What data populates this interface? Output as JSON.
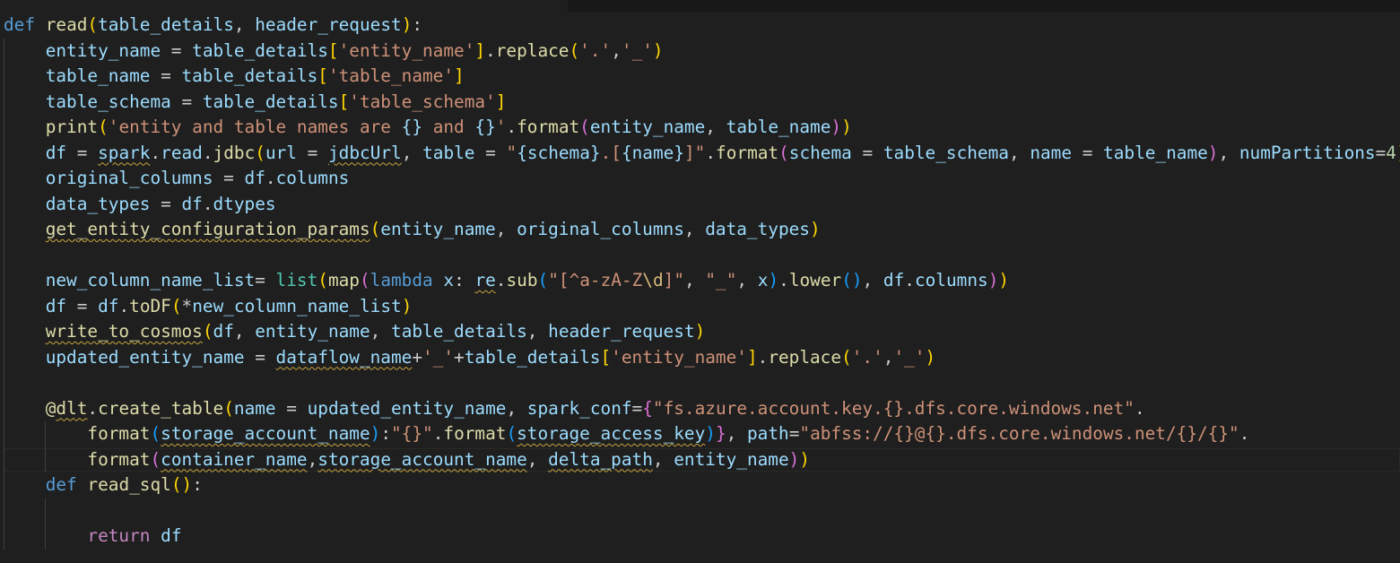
{
  "editor": {
    "language": "python",
    "current_line_index": 17,
    "colors": {
      "background": "#1f1f1f",
      "keyword": "#569cd6",
      "function": "#dcdcaa",
      "variable": "#9cdcfe",
      "string": "#ce9178",
      "number": "#b5cea8",
      "control": "#c586c0",
      "builtin": "#4ec9b0",
      "bracket_1": "#ffd700",
      "bracket_2": "#da70d6",
      "bracket_3": "#179fff",
      "squiggle": "#c8a43c"
    },
    "lines": [
      {
        "indent": 0,
        "tokens": [
          [
            "kw",
            "def"
          ],
          [
            "pun",
            " "
          ],
          [
            "fn",
            "read"
          ],
          [
            "b1",
            "("
          ],
          [
            "var",
            "table_details"
          ],
          [
            "pun",
            ", "
          ],
          [
            "var",
            "header_request"
          ],
          [
            "b1",
            ")"
          ],
          [
            "pun",
            ":"
          ]
        ]
      },
      {
        "indent": 1,
        "tokens": [
          [
            "var",
            "entity_name"
          ],
          [
            "pun",
            " = "
          ],
          [
            "var",
            "table_details"
          ],
          [
            "b1",
            "["
          ],
          [
            "str",
            "'entity_name'"
          ],
          [
            "b1",
            "]"
          ],
          [
            "pun",
            "."
          ],
          [
            "fn",
            "replace"
          ],
          [
            "b1",
            "("
          ],
          [
            "str",
            "'.'"
          ],
          [
            "pun",
            ","
          ],
          [
            "str",
            "'_'"
          ],
          [
            "b1",
            ")"
          ]
        ]
      },
      {
        "indent": 1,
        "tokens": [
          [
            "var",
            "table_name"
          ],
          [
            "pun",
            " = "
          ],
          [
            "var",
            "table_details"
          ],
          [
            "b1",
            "["
          ],
          [
            "str",
            "'table_name'"
          ],
          [
            "b1",
            "]"
          ]
        ]
      },
      {
        "indent": 1,
        "tokens": [
          [
            "var",
            "table_schema"
          ],
          [
            "pun",
            " = "
          ],
          [
            "var",
            "table_details"
          ],
          [
            "b1",
            "["
          ],
          [
            "str",
            "'table_schema'"
          ],
          [
            "b1",
            "]"
          ]
        ]
      },
      {
        "indent": 1,
        "tokens": [
          [
            "fn",
            "print"
          ],
          [
            "b1",
            "("
          ],
          [
            "str",
            "'entity and table names are "
          ],
          [
            "var",
            "{}"
          ],
          [
            "str",
            " and "
          ],
          [
            "var",
            "{}"
          ],
          [
            "str",
            "'"
          ],
          [
            "pun",
            "."
          ],
          [
            "fn",
            "format"
          ],
          [
            "b2",
            "("
          ],
          [
            "var",
            "entity_name"
          ],
          [
            "pun",
            ", "
          ],
          [
            "var",
            "table_name"
          ],
          [
            "b2",
            ")"
          ],
          [
            "b1",
            ")"
          ]
        ]
      },
      {
        "indent": 1,
        "tokens": [
          [
            "var",
            "df"
          ],
          [
            "pun",
            " = "
          ],
          [
            "var",
            "spark",
            "sq"
          ],
          [
            "pun",
            "."
          ],
          [
            "var",
            "read"
          ],
          [
            "pun",
            "."
          ],
          [
            "fn",
            "jdbc"
          ],
          [
            "b1",
            "("
          ],
          [
            "var",
            "url"
          ],
          [
            "pun",
            " = "
          ],
          [
            "var",
            "jdbcUrl",
            "sq"
          ],
          [
            "pun",
            ", "
          ],
          [
            "var",
            "table"
          ],
          [
            "pun",
            " = "
          ],
          [
            "str",
            "\""
          ],
          [
            "var",
            "{schema}"
          ],
          [
            "str",
            ".["
          ],
          [
            "var",
            "{name}"
          ],
          [
            "str",
            "]\""
          ],
          [
            "pun",
            "."
          ],
          [
            "fn",
            "format"
          ],
          [
            "b2",
            "("
          ],
          [
            "var",
            "schema"
          ],
          [
            "pun",
            " = "
          ],
          [
            "var",
            "table_schema"
          ],
          [
            "pun",
            ", "
          ],
          [
            "var",
            "name"
          ],
          [
            "pun",
            " = "
          ],
          [
            "var",
            "table_name"
          ],
          [
            "b2",
            ")"
          ],
          [
            "pun",
            ", "
          ],
          [
            "var",
            "numPartitions"
          ],
          [
            "pun",
            "="
          ],
          [
            "num",
            "4"
          ],
          [
            "b1",
            ")"
          ]
        ]
      },
      {
        "indent": 1,
        "tokens": [
          [
            "var",
            "original_columns"
          ],
          [
            "pun",
            " = "
          ],
          [
            "var",
            "df"
          ],
          [
            "pun",
            "."
          ],
          [
            "var",
            "columns"
          ]
        ]
      },
      {
        "indent": 1,
        "tokens": [
          [
            "var",
            "data_types"
          ],
          [
            "pun",
            " = "
          ],
          [
            "var",
            "df"
          ],
          [
            "pun",
            "."
          ],
          [
            "var",
            "dtypes"
          ]
        ]
      },
      {
        "indent": 1,
        "tokens": [
          [
            "fn",
            "get_entity_configuration_params",
            "sq"
          ],
          [
            "b1",
            "("
          ],
          [
            "var",
            "entity_name"
          ],
          [
            "pun",
            ", "
          ],
          [
            "var",
            "original_columns"
          ],
          [
            "pun",
            ", "
          ],
          [
            "var",
            "data_types"
          ],
          [
            "b1",
            ")"
          ]
        ]
      },
      {
        "indent": 1,
        "tokens": []
      },
      {
        "indent": 1,
        "tokens": [
          [
            "var",
            "new_column_name_list"
          ],
          [
            "pun",
            "= "
          ],
          [
            "bi",
            "list"
          ],
          [
            "b1",
            "("
          ],
          [
            "fn",
            "map"
          ],
          [
            "b2",
            "("
          ],
          [
            "kw",
            "lambda"
          ],
          [
            "pun",
            " "
          ],
          [
            "var",
            "x"
          ],
          [
            "pun",
            ": "
          ],
          [
            "var",
            "re",
            "sq"
          ],
          [
            "pun",
            "."
          ],
          [
            "fn",
            "sub"
          ],
          [
            "b3",
            "("
          ],
          [
            "str",
            "\"[^a-zA-Z"
          ],
          [
            "esc",
            "\\d"
          ],
          [
            "str",
            "]\""
          ],
          [
            "pun",
            ", "
          ],
          [
            "str",
            "\"_\""
          ],
          [
            "pun",
            ", "
          ],
          [
            "var",
            "x"
          ],
          [
            "b3",
            ")"
          ],
          [
            "pun",
            "."
          ],
          [
            "fn",
            "lower"
          ],
          [
            "b3",
            "()"
          ],
          [
            "pun",
            ", "
          ],
          [
            "var",
            "df"
          ],
          [
            "pun",
            "."
          ],
          [
            "var",
            "columns"
          ],
          [
            "b2",
            ")"
          ],
          [
            "b1",
            ")"
          ]
        ]
      },
      {
        "indent": 1,
        "tokens": [
          [
            "var",
            "df"
          ],
          [
            "pun",
            " = "
          ],
          [
            "var",
            "df"
          ],
          [
            "pun",
            "."
          ],
          [
            "fn",
            "toDF"
          ],
          [
            "b1",
            "("
          ],
          [
            "pun",
            "*"
          ],
          [
            "var",
            "new_column_name_list"
          ],
          [
            "b1",
            ")"
          ]
        ]
      },
      {
        "indent": 1,
        "tokens": [
          [
            "fn",
            "write_to_cosmos",
            "sq"
          ],
          [
            "b1",
            "("
          ],
          [
            "var",
            "df"
          ],
          [
            "pun",
            ", "
          ],
          [
            "var",
            "entity_name"
          ],
          [
            "pun",
            ", "
          ],
          [
            "var",
            "table_details"
          ],
          [
            "pun",
            ", "
          ],
          [
            "var",
            "header_request"
          ],
          [
            "b1",
            ")"
          ]
        ]
      },
      {
        "indent": 1,
        "tokens": [
          [
            "var",
            "updated_entity_name"
          ],
          [
            "pun",
            " = "
          ],
          [
            "var",
            "dataflow_name",
            "sq"
          ],
          [
            "pun",
            "+"
          ],
          [
            "str",
            "'_'"
          ],
          [
            "pun",
            "+"
          ],
          [
            "var",
            "table_details"
          ],
          [
            "b1",
            "["
          ],
          [
            "str",
            "'entity_name'"
          ],
          [
            "b1",
            "]"
          ],
          [
            "pun",
            "."
          ],
          [
            "fn",
            "replace"
          ],
          [
            "b1",
            "("
          ],
          [
            "str",
            "'.'"
          ],
          [
            "pun",
            ","
          ],
          [
            "str",
            "'_'"
          ],
          [
            "b1",
            ")"
          ]
        ]
      },
      {
        "indent": 1,
        "tokens": []
      },
      {
        "indent": 1,
        "tokens": [
          [
            "fn",
            "@"
          ],
          [
            "fn",
            "dlt",
            "sq"
          ],
          [
            "pun",
            "."
          ],
          [
            "fn",
            "create_table"
          ],
          [
            "b1",
            "("
          ],
          [
            "var",
            "name"
          ],
          [
            "pun",
            " = "
          ],
          [
            "var",
            "updated_entity_name"
          ],
          [
            "pun",
            ", "
          ],
          [
            "var",
            "spark_conf"
          ],
          [
            "pun",
            "="
          ],
          [
            "b2",
            "{"
          ],
          [
            "str",
            "\"fs.azure.account.key.{}.dfs.core.windows.net\""
          ],
          [
            "pun",
            "."
          ]
        ]
      },
      {
        "indent": 2,
        "tokens": [
          [
            "fn",
            "format"
          ],
          [
            "b3",
            "("
          ],
          [
            "var",
            "storage_account_name",
            "sq"
          ],
          [
            "b3",
            ")"
          ],
          [
            "pun",
            ":"
          ],
          [
            "str",
            "\"{}\""
          ],
          [
            "pun",
            "."
          ],
          [
            "fn",
            "format"
          ],
          [
            "b3",
            "("
          ],
          [
            "var",
            "storage_access_key",
            "sq"
          ],
          [
            "b3",
            ")"
          ],
          [
            "b2",
            "}"
          ],
          [
            "pun",
            ", "
          ],
          [
            "var",
            "path"
          ],
          [
            "pun",
            "="
          ],
          [
            "str",
            "\"abfss://{}@{}.dfs.core.windows.net/{}/{}\""
          ],
          [
            "pun",
            "."
          ]
        ]
      },
      {
        "indent": 2,
        "tokens": [
          [
            "fn",
            "format"
          ],
          [
            "b2",
            "("
          ],
          [
            "var",
            "container_name",
            "sq"
          ],
          [
            "pun",
            ","
          ],
          [
            "var",
            "storage_account_name",
            "sq"
          ],
          [
            "pun",
            ", "
          ],
          [
            "var",
            "delta_path",
            "sq"
          ],
          [
            "pun",
            ", "
          ],
          [
            "var",
            "entity_name"
          ],
          [
            "b2",
            ")"
          ],
          [
            "b1",
            ")"
          ]
        ]
      },
      {
        "indent": 1,
        "tokens": [
          [
            "kw",
            "def"
          ],
          [
            "pun",
            " "
          ],
          [
            "fn",
            "read_sql"
          ],
          [
            "b1",
            "()"
          ],
          [
            "pun",
            ":"
          ]
        ]
      },
      {
        "indent": 2,
        "tokens": []
      },
      {
        "indent": 2,
        "tokens": [
          [
            "ctl",
            "return"
          ],
          [
            "pun",
            " "
          ],
          [
            "var",
            "df"
          ]
        ]
      }
    ]
  }
}
